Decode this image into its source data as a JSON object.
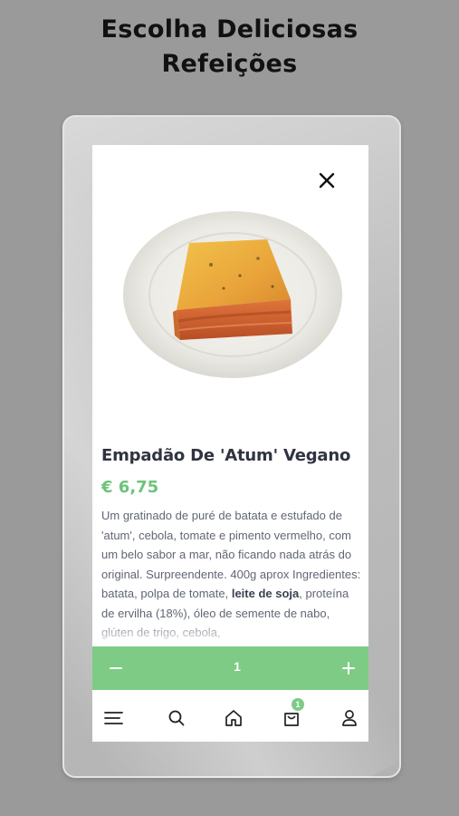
{
  "headline": {
    "line1": "Escolha Deliciosas",
    "line2": "Refeições"
  },
  "product": {
    "title": "Empadão De 'Atum' Vegano",
    "price": "€ 6,75",
    "description_part1": "Um gratinado de puré de batata e estufado de 'atum', cebola, tomate e pimento vermelho, com um belo sabor a mar, não ficando nada atrás do original. Surpreendente. 400g aprox Ingredientes: batata, polpa de tomate, ",
    "description_bold": "leite de soja",
    "description_part2": ", proteína de ervilha (18%), óleo de semente de nabo, glúten de trigo, cebola,"
  },
  "quantity": {
    "minus_label": "−",
    "value": "1",
    "plus_label": "+"
  },
  "nav": {
    "cart_badge": "1",
    "items": [
      "menu-icon",
      "search-icon",
      "home-icon",
      "cart-icon",
      "user-icon"
    ]
  },
  "colors": {
    "accent_green": "#7ecb86",
    "price_green": "#6bc47a",
    "background": "#9a9a9a",
    "title_text": "#2f3440"
  }
}
